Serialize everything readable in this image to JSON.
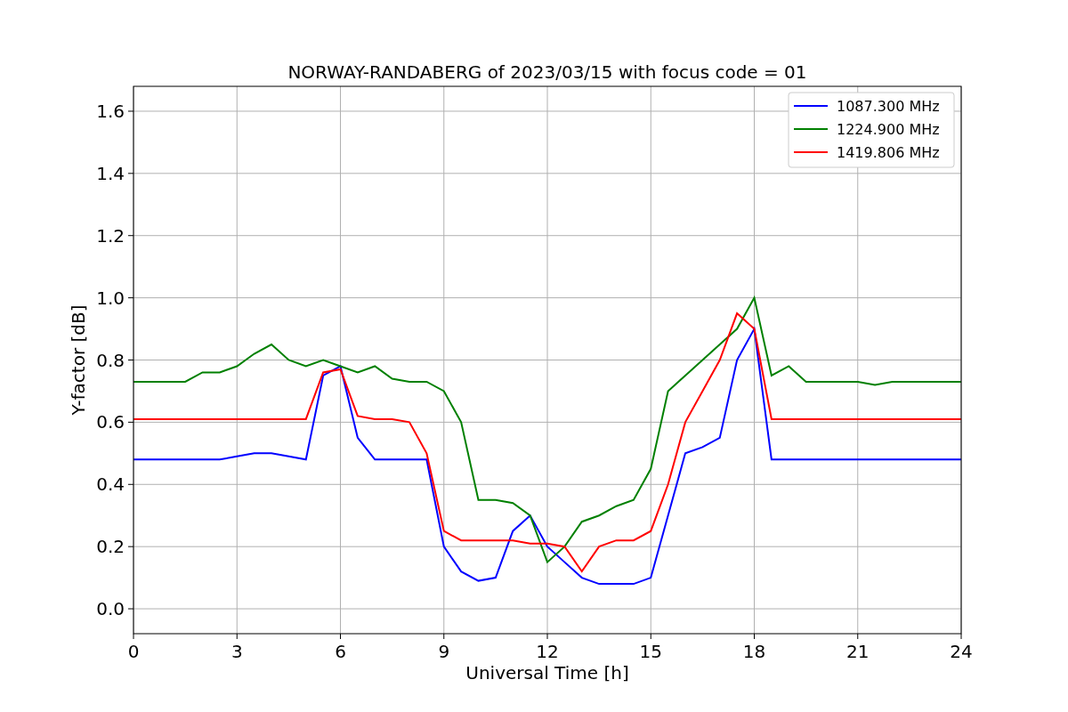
{
  "chart_data": {
    "type": "line",
    "title": "NORWAY-RANDABERG of 2023/03/15 with focus code = 01",
    "xlabel": "Universal Time [h]",
    "ylabel": "Y-factor [dB]",
    "x": [
      0,
      0.5,
      1,
      1.5,
      2,
      2.5,
      3,
      3.5,
      4,
      4.5,
      5,
      5.5,
      6,
      6.5,
      7,
      7.5,
      8,
      8.5,
      9,
      9.5,
      10,
      10.5,
      11,
      11.5,
      12,
      12.5,
      13,
      13.5,
      14,
      14.5,
      15,
      15.5,
      16,
      16.5,
      17,
      17.5,
      18,
      18.5,
      19,
      19.5,
      20,
      20.5,
      21,
      21.5,
      22,
      22.5,
      23,
      23.5,
      24
    ],
    "series": [
      {
        "name": "1087.300 MHz",
        "color": "#0000ff",
        "values": [
          0.48,
          0.48,
          0.48,
          0.48,
          0.48,
          0.48,
          0.49,
          0.5,
          0.5,
          0.49,
          0.48,
          0.75,
          0.78,
          0.55,
          0.48,
          0.48,
          0.48,
          0.48,
          0.2,
          0.12,
          0.09,
          0.1,
          0.25,
          0.3,
          0.2,
          0.15,
          0.1,
          0.08,
          0.08,
          0.08,
          0.1,
          0.3,
          0.5,
          0.52,
          0.55,
          0.8,
          0.9,
          0.48,
          0.48,
          0.48,
          0.48,
          0.48,
          0.48,
          0.48,
          0.48,
          0.48,
          0.48,
          0.48,
          0.48
        ]
      },
      {
        "name": "1224.900 MHz",
        "color": "#008000",
        "values": [
          0.73,
          0.73,
          0.73,
          0.73,
          0.76,
          0.76,
          0.78,
          0.82,
          0.85,
          0.8,
          0.78,
          0.8,
          0.78,
          0.76,
          0.78,
          0.74,
          0.73,
          0.73,
          0.7,
          0.6,
          0.35,
          0.35,
          0.34,
          0.3,
          0.15,
          0.2,
          0.28,
          0.3,
          0.33,
          0.35,
          0.45,
          0.7,
          0.75,
          0.8,
          0.85,
          0.9,
          1.0,
          0.75,
          0.78,
          0.73,
          0.73,
          0.73,
          0.73,
          0.72,
          0.73,
          0.73,
          0.73,
          0.73,
          0.73
        ]
      },
      {
        "name": "1419.806 MHz",
        "color": "#ff0000",
        "values": [
          0.61,
          0.61,
          0.61,
          0.61,
          0.61,
          0.61,
          0.61,
          0.61,
          0.61,
          0.61,
          0.61,
          0.76,
          0.77,
          0.62,
          0.61,
          0.61,
          0.6,
          0.5,
          0.25,
          0.22,
          0.22,
          0.22,
          0.22,
          0.21,
          0.21,
          0.2,
          0.12,
          0.2,
          0.22,
          0.22,
          0.25,
          0.4,
          0.6,
          0.7,
          0.8,
          0.95,
          0.9,
          0.61,
          0.61,
          0.61,
          0.61,
          0.61,
          0.61,
          0.61,
          0.61,
          0.61,
          0.61,
          0.61,
          0.61
        ]
      }
    ],
    "grid": true,
    "legend": true,
    "xlim": [
      0,
      24
    ],
    "ylim": [
      -0.08,
      1.68
    ],
    "xticks": [
      0,
      3,
      6,
      9,
      12,
      15,
      18,
      21,
      24
    ],
    "yticks": [
      {
        "value": 0,
        "label": "0.0"
      },
      {
        "value": 0.2,
        "label": "0.2"
      },
      {
        "value": 0.4,
        "label": "0.4"
      },
      {
        "value": 0.6,
        "label": "0.6"
      },
      {
        "value": 0.8,
        "label": "0.8"
      },
      {
        "value": 1,
        "label": "1.0"
      },
      {
        "value": 1.2,
        "label": "1.2"
      },
      {
        "value": 1.4,
        "label": "1.4"
      },
      {
        "value": 1.6,
        "label": "1.6"
      }
    ]
  }
}
